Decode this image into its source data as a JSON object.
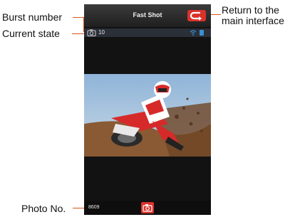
{
  "callouts": {
    "burst_number": "Burst number",
    "current_state": "Current state",
    "return_line1": "Return to the",
    "return_line2": "main interface",
    "photo_no": "Photo No."
  },
  "app": {
    "title": "Fast Shot",
    "burst_count": "10",
    "photo_number": "8609"
  },
  "icons": {
    "state": "camera-icon",
    "back": "return-arrow-icon",
    "wifi": "wifi-icon",
    "battery": "battery-icon",
    "shutter": "camera-shutter-icon"
  },
  "colors": {
    "accent": "#d9322b",
    "callout_line": "#d9541a",
    "screen_bg": "#121212",
    "status_bar": "#2b2f38"
  }
}
